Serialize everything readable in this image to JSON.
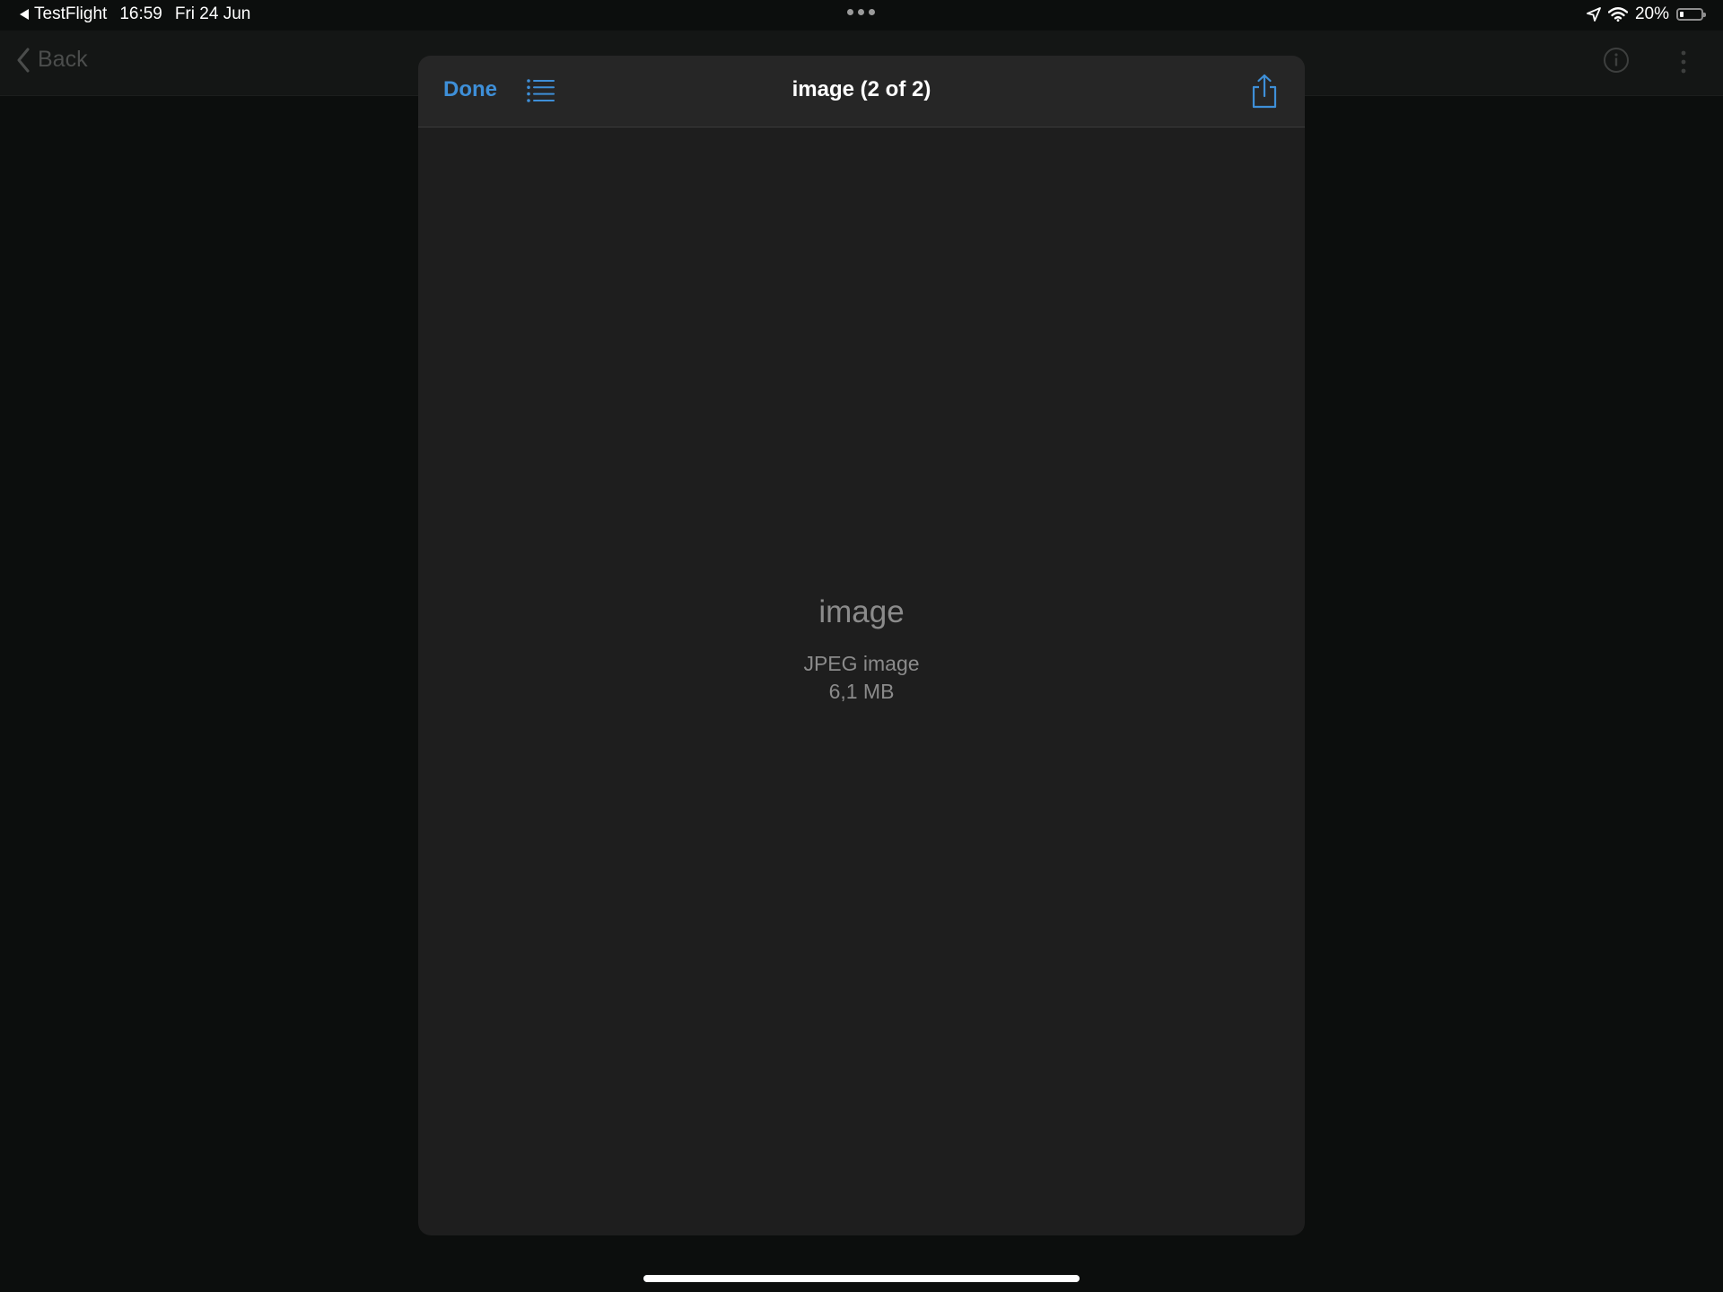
{
  "status_bar": {
    "back_app": "TestFlight",
    "time": "16:59",
    "date": "Fri 24 Jun",
    "battery_percent": "20%",
    "battery_level": 0.2
  },
  "background_nav": {
    "back_label": "Back"
  },
  "sheet": {
    "done_label": "Done",
    "title": "image (2 of 2)",
    "file_name": "image",
    "file_type": "JPEG image",
    "file_size": "6,1 MB"
  },
  "colors": {
    "accent": "#3e8fd8",
    "sheet_background": "#1e1e1e",
    "header_background": "#262626",
    "screen_background": "#0c0e0d"
  },
  "icons": {
    "list": "list-bullet-icon",
    "share": "share-icon",
    "location": "location-arrow-icon",
    "wifi": "wifi-icon",
    "battery": "battery-icon",
    "info": "info-circle-icon",
    "more": "more-vertical-icon"
  }
}
